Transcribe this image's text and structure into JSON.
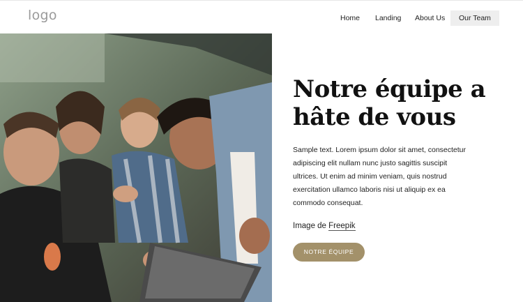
{
  "header": {
    "logo": "logo",
    "nav": [
      {
        "label": "Home",
        "active": false
      },
      {
        "label": "Landing",
        "active": false
      },
      {
        "label": "About Us",
        "active": false
      },
      {
        "label": "Our Team",
        "active": true
      }
    ]
  },
  "hero": {
    "heading_line1": "Notre équipe a",
    "heading_line2": "hâte de vous",
    "body": "Sample text. Lorem ipsum dolor sit amet, consectetur adipiscing elit nullam nunc justo sagittis suscipit ultrices. Ut enim ad minim veniam, quis nostrud exercitation ullamco laboris nisi ut aliquip ex ea commodo consequat.",
    "credit_prefix": "Image de",
    "credit_link": "Freepik",
    "button_label": "NOTRE ÉQUIPE"
  },
  "colors": {
    "accent": "#a3916a",
    "active_nav_bg": "#eeeeee",
    "logo": "#9a9a9a"
  }
}
